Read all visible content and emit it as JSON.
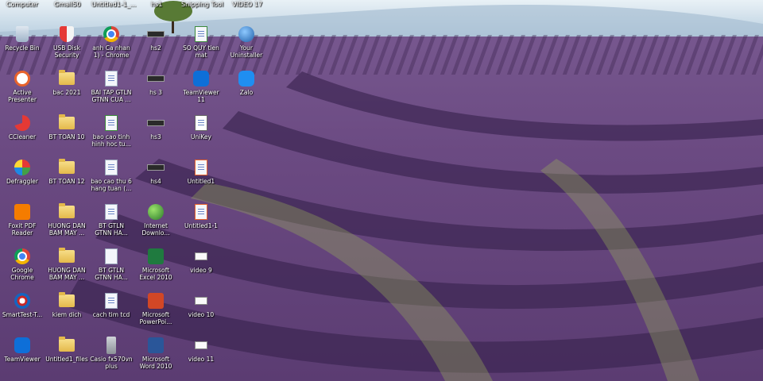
{
  "top_row": [
    {
      "label": "Computer"
    },
    {
      "label": "Gmail50"
    },
    {
      "label": "Untitled1-1_..."
    },
    {
      "label": "hs1"
    },
    {
      "label": "Snipping Tool"
    },
    {
      "label": "VIDEO 17"
    }
  ],
  "icons": [
    {
      "label": "Recycle Bin",
      "icon": "recycle-bin-icon"
    },
    {
      "label": "USB Disk\nSecurity",
      "icon": "shield-icon"
    },
    {
      "label": "anh Ca nhan\n1) - Chrome",
      "icon": "chrome-icon"
    },
    {
      "label": "hs2",
      "icon": "device-icon"
    },
    {
      "label": "SO QUY tien\nmat",
      "icon": "spreadsheet-icon"
    },
    {
      "label": "Your\nUninstaller",
      "icon": "uninstaller-icon"
    },
    {
      "label": "Active\nPresenter",
      "icon": "presenter-icon"
    },
    {
      "label": "bac 2021",
      "icon": "folder-icon"
    },
    {
      "label": "BAI TAP GTLN\nGTNN CUA ...",
      "icon": "document-icon"
    },
    {
      "label": "hs 3",
      "icon": "device-icon"
    },
    {
      "label": "TeamViewer\n11",
      "icon": "teamviewer-icon"
    },
    {
      "label": "Zalo",
      "icon": "zalo-icon"
    },
    {
      "label": "CCleaner",
      "icon": "ccleaner-icon"
    },
    {
      "label": "BT TOAN 10",
      "icon": "folder-icon"
    },
    {
      "label": "bao cao tinh\nhinh hoc tu...",
      "icon": "spreadsheet-icon"
    },
    {
      "label": "hs3",
      "icon": "device-icon"
    },
    {
      "label": "UniKey",
      "icon": "unikey-icon"
    },
    {
      "label": "Defraggler",
      "icon": "defraggler-icon"
    },
    {
      "label": "BT TOAN 12",
      "icon": "folder-icon"
    },
    {
      "label": "bao cao thu 6\nhang tuan (...",
      "icon": "document-icon"
    },
    {
      "label": "hs4",
      "icon": "device-icon"
    },
    {
      "label": "Untitled1",
      "icon": "presenter-doc-icon"
    },
    {
      "label": "Foxit PDF\nReader",
      "icon": "foxit-icon"
    },
    {
      "label": "HUONG DAN\nBAM MAY ...",
      "icon": "folder-icon"
    },
    {
      "label": "BT GTLN\nGTNN HA...",
      "icon": "document-icon"
    },
    {
      "label": "Internet\nDownlo...",
      "icon": "idm-icon"
    },
    {
      "label": "Untitled1-1",
      "icon": "presenter-doc-icon"
    },
    {
      "label": "Google\nChrome",
      "icon": "chrome-icon"
    },
    {
      "label": "HUONG DAN\nBAM MAY ...",
      "icon": "folder-icon"
    },
    {
      "label": "BT GTLN\nGTNN HA...",
      "icon": "docx-icon"
    },
    {
      "label": "Microsoft\nExcel 2010",
      "icon": "excel-icon"
    },
    {
      "label": "video 9",
      "icon": "video-icon"
    },
    {
      "label": "SmartTest-T...",
      "icon": "smarttest-icon"
    },
    {
      "label": "kiem dich",
      "icon": "folder-icon"
    },
    {
      "label": "cach tim tcd",
      "icon": "document-icon"
    },
    {
      "label": "Microsoft\nPowerPoi...",
      "icon": "powerpoint-icon"
    },
    {
      "label": "video 10",
      "icon": "video-icon"
    },
    {
      "label": "TeamViewer",
      "icon": "teamviewer-icon"
    },
    {
      "label": "Untitled1_files",
      "icon": "folder-icon"
    },
    {
      "label": "Casio fx570vn\nplus",
      "icon": "calculator-icon"
    },
    {
      "label": "Microsoft\nWord 2010",
      "icon": "word-icon"
    },
    {
      "label": "video 11",
      "icon": "video-icon"
    }
  ],
  "colors": {
    "sky": "#cfe3ef",
    "lavender_dark": "#4a2f63",
    "lavender_light": "#8e6fb0",
    "grass": "#6d8a3c"
  }
}
